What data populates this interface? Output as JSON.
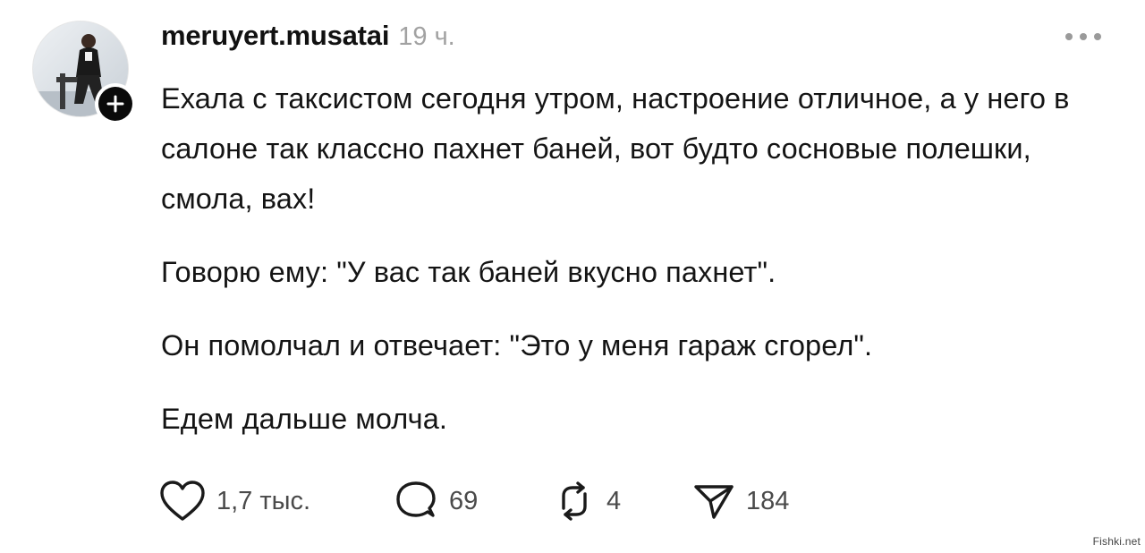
{
  "post": {
    "author": {
      "username": "meruyert.musatai",
      "avatar_icon": "avatar-photo",
      "follow_icon": "plus-icon"
    },
    "time_ago": "19 ч.",
    "more_icon": "more-horizontal-icon",
    "paragraphs": [
      "Ехала с таксистом сегодня утром, настроение отличное, а у него в салоне так классно пахнет баней, вот будто сосновые полешки, смола, вах!",
      "Говорю ему: \"У вас так баней вкусно пахнет\".",
      "Он помолчал и отвечает: \"Это у меня гараж сгорел\".",
      "Едем дальше молча."
    ],
    "actions": {
      "likes": {
        "icon": "heart-icon",
        "count": "1,7 тыс."
      },
      "replies": {
        "icon": "comment-icon",
        "count": "69"
      },
      "reposts": {
        "icon": "repost-icon",
        "count": "4"
      },
      "shares": {
        "icon": "send-icon",
        "count": "184"
      }
    }
  },
  "watermark": "Fishki.net"
}
